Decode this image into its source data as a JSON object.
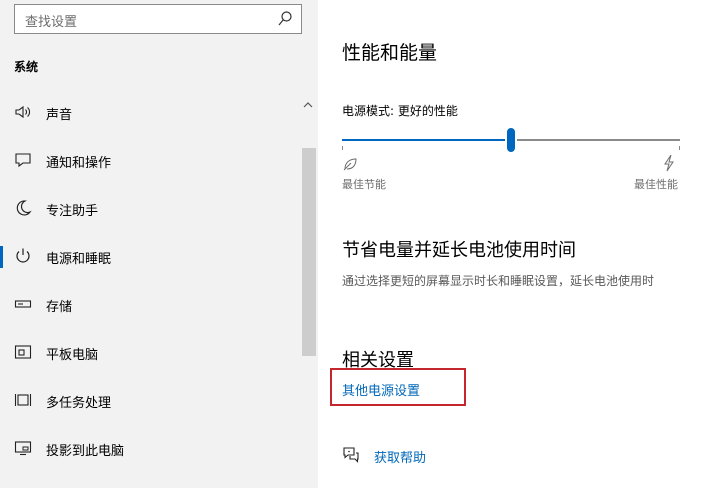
{
  "search": {
    "placeholder": "查找设置",
    "icon": "search-icon"
  },
  "sidebar": {
    "section_title": "系统",
    "items": [
      {
        "label": "声音",
        "icon": "speaker-icon"
      },
      {
        "label": "通知和操作",
        "icon": "notification-icon"
      },
      {
        "label": "专注助手",
        "icon": "moon-icon"
      },
      {
        "label": "电源和睡眠",
        "icon": "power-icon",
        "active": true
      },
      {
        "label": "存储",
        "icon": "storage-icon"
      },
      {
        "label": "平板电脑",
        "icon": "tablet-icon"
      },
      {
        "label": "多任务处理",
        "icon": "multitask-icon"
      },
      {
        "label": "投影到此电脑",
        "icon": "project-icon"
      }
    ]
  },
  "content": {
    "title": "性能和能量",
    "power_mode_label": "电源模式: 更好的性能",
    "slider": {
      "value_fraction": 0.5,
      "min_label": "最佳节能",
      "max_label": "最佳性能"
    },
    "battery_title": "节省电量并延长电池使用时间",
    "battery_desc": "通过选择更短的屏幕显示时长和睡眠设置，延长电池使用时",
    "related_title": "相关设置",
    "related_link": "其他电源设置",
    "help_link": "获取帮助"
  },
  "colors": {
    "accent": "#0067c0",
    "link": "#0067b8",
    "highlight_box": "#c4262e",
    "sidebar_bg": "#f2f2f2"
  }
}
